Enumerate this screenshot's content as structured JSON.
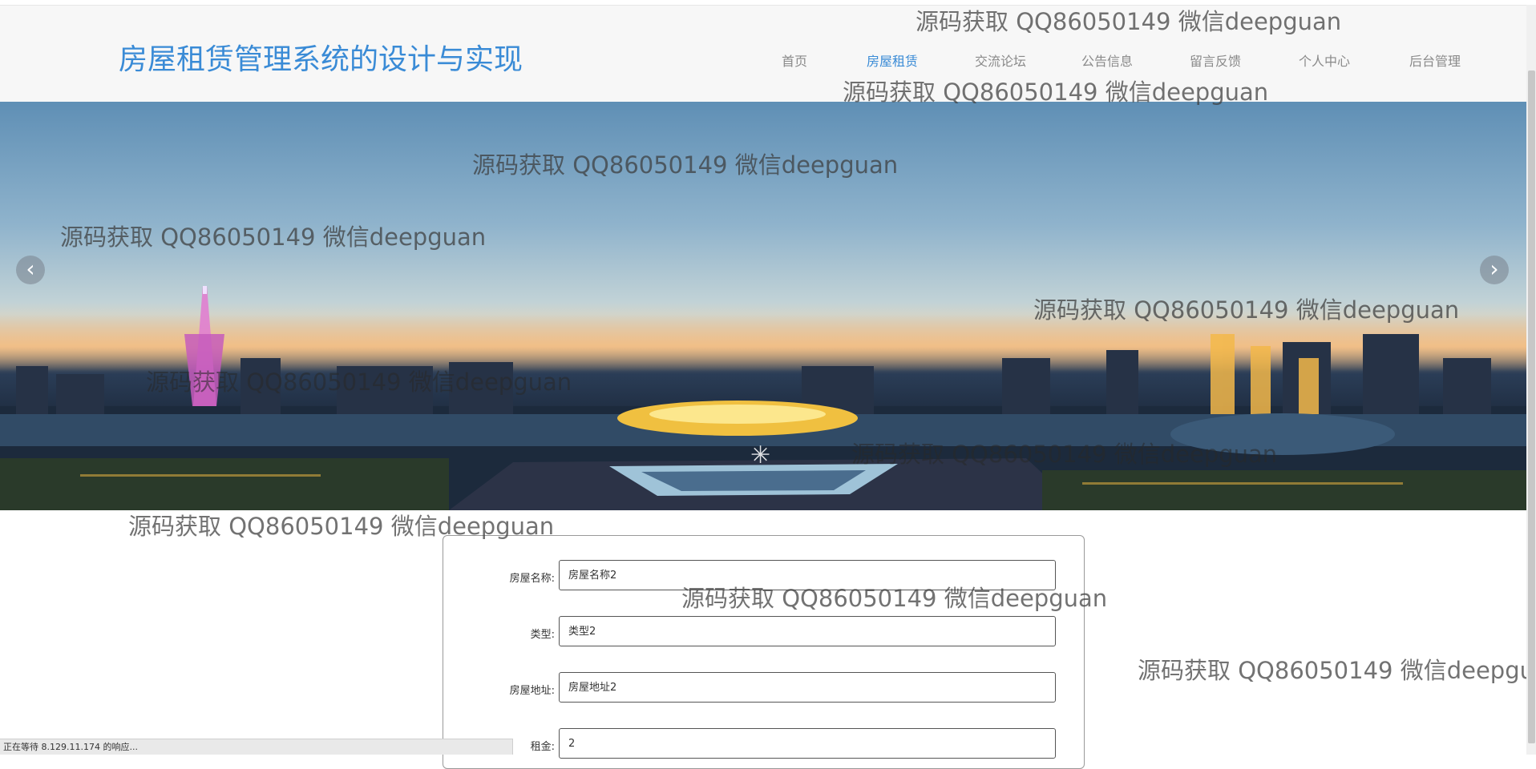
{
  "header": {
    "site_title": "房屋租赁管理系统的设计与实现",
    "nav": [
      {
        "label": "首页"
      },
      {
        "label": "房屋租赁"
      },
      {
        "label": "交流论坛"
      },
      {
        "label": "公告信息"
      },
      {
        "label": "留言反馈"
      },
      {
        "label": "个人中心"
      },
      {
        "label": "后台管理"
      }
    ],
    "active_nav": "房屋租赁",
    "accent_color": "#3a8bd6"
  },
  "banner": {
    "prev_icon": "chevron-left-icon",
    "next_icon": "chevron-right-icon",
    "prev_glyph": "‹",
    "next_glyph": "›"
  },
  "form": {
    "fields": [
      {
        "label": "房屋名称:",
        "value": "房屋名称2"
      },
      {
        "label": "类型:",
        "value": "类型2"
      },
      {
        "label": "房屋地址:",
        "value": "房屋地址2"
      },
      {
        "label": "租金:",
        "value": "2"
      }
    ]
  },
  "watermark_text": "源码获取 QQ86050149 微信deepguan",
  "status_bar": {
    "text": "正在等待 8.129.11.174 的响应..."
  }
}
